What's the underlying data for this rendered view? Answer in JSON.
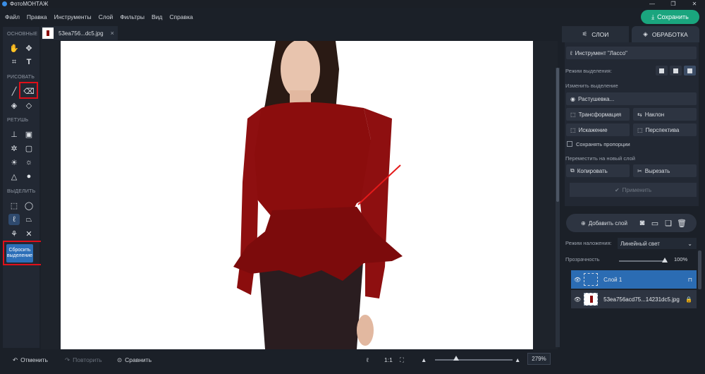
{
  "window": {
    "title": "ФотоМОНТАЖ",
    "controls": [
      "—",
      "❐",
      "✕"
    ]
  },
  "menu": [
    "Файл",
    "Правка",
    "Инструменты",
    "Слой",
    "Фильтры",
    "Вид",
    "Справка"
  ],
  "save_button": {
    "label": "Сохранить",
    "icon": "⤓"
  },
  "toolbox": {
    "sections": {
      "basic": "ОСНОВНЫЕ",
      "draw": "РИСОВАТЬ",
      "retouch": "РЕТУШЬ",
      "select": "ВЫДЕЛИТЬ"
    },
    "reset_label": "Сбросить выделение"
  },
  "document_tab": {
    "name": "53ea756...dc5.jpg",
    "close": "×"
  },
  "bottom": {
    "undo": "Отменить",
    "redo": "Повторить",
    "compare": "Сравнить",
    "ratio": "1:1",
    "zoom": "279%"
  },
  "right_tabs": {
    "layers": "СЛОИ",
    "processing": "ОБРАБОТКА"
  },
  "panel": {
    "tool_button": "Инструмент \"Лассо\"",
    "selection_mode": "Режим выделения:",
    "change_selection": "Изменить выделение",
    "feather": "Растушевка...",
    "transform": "Трансформация",
    "tilt": "Наклон",
    "distortion": "Искажение",
    "perspective": "Перспектива",
    "keep_proportions": "Сохранять пропорции",
    "move_to_layer": "Переместить на новый слой",
    "copy": "Копировать",
    "cut": "Вырезать",
    "apply": "Применить"
  },
  "layers": {
    "add_layer": "Добавить слой",
    "blend_label": "Режим наложения:",
    "blend_value": "Линейный свет",
    "opacity_label": "Прозрачность",
    "opacity_value": "100%",
    "opacity_fraction": 1.0,
    "items": [
      {
        "name": "Слой 1",
        "active": true
      },
      {
        "name": "53ea756acd75...14231dc5.jpg",
        "active": false
      }
    ]
  },
  "zoom_fraction": 0.25,
  "colors": {
    "accent": "#1aa57e",
    "selection": "#2b6cb3",
    "highlight": "#e0101a",
    "dress": "#8b0d0d"
  }
}
